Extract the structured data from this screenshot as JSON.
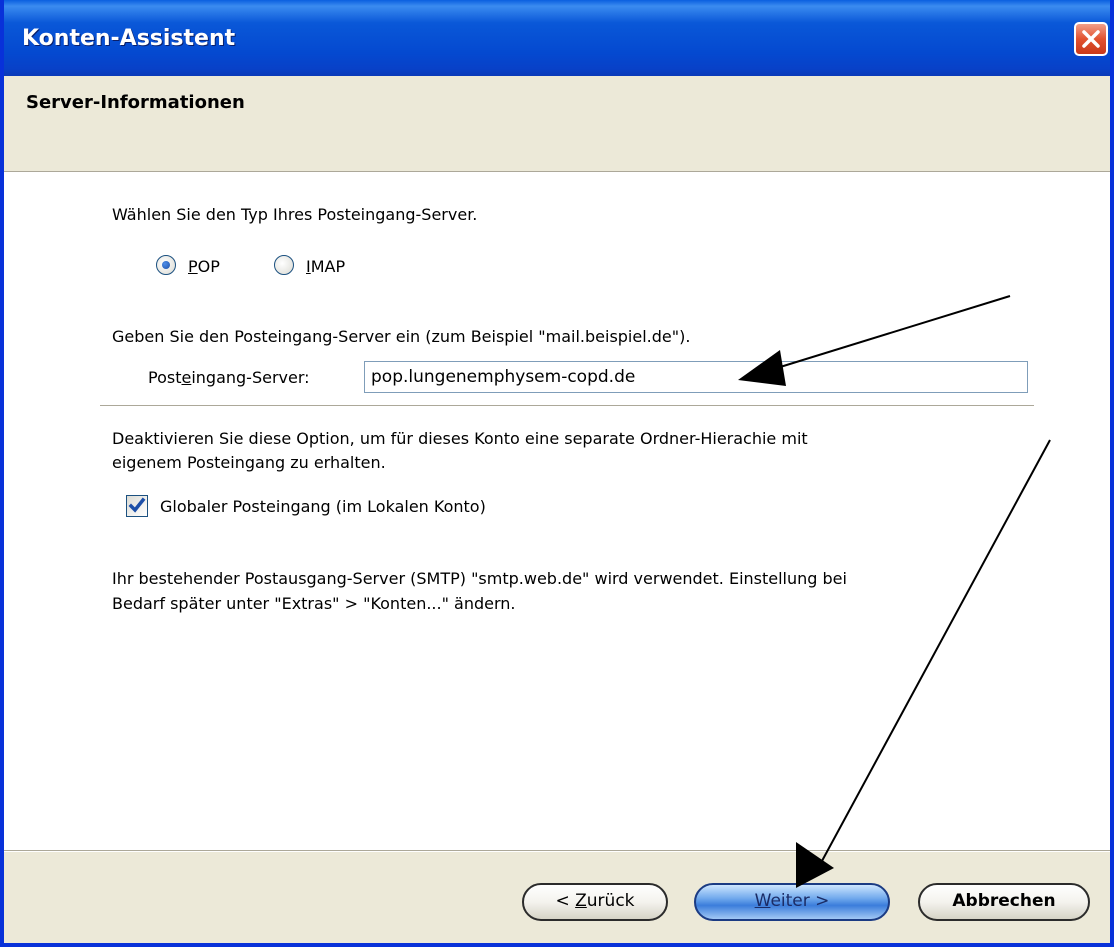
{
  "window": {
    "title": "Konten-Assistent"
  },
  "header": {
    "title": "Server-Informationen"
  },
  "server_type": {
    "prompt": "Wählen Sie den Typ Ihres Posteingang-Server.",
    "options": [
      {
        "label": "POP",
        "accesskey": "P",
        "rest": "OP",
        "selected": true
      },
      {
        "label": "IMAP",
        "accesskey": "I",
        "rest": "MAP",
        "selected": false
      }
    ]
  },
  "incoming": {
    "prompt": "Geben Sie den Posteingang-Server ein (zum Beispiel \"mail.beispiel.de\").",
    "label_pre": "Post",
    "label_key": "e",
    "label_post": "ingang-Server:",
    "value": "pop.lungenemphysem-copd.de"
  },
  "global_inbox": {
    "description_line1": "Deaktivieren Sie diese Option, um für dieses Konto eine separate Ordner-Hierachie mit",
    "description_line2": "eigenem Posteingang zu erhalten.",
    "checkbox_label": "Globaler Posteingang (im Lokalen Konto)",
    "checked": true
  },
  "smtp_note": {
    "line1": "Ihr bestehender Postausgang-Server (SMTP) \"smtp.web.de\" wird verwendet. Einstellung bei",
    "line2": "Bedarf später unter \"Extras\" > \"Konten...\" ändern."
  },
  "buttons": {
    "back_pre": "< ",
    "back_key": "Z",
    "back_post": "urück",
    "next_key": "W",
    "next_post": "eiter >",
    "cancel": "Abbrechen"
  }
}
